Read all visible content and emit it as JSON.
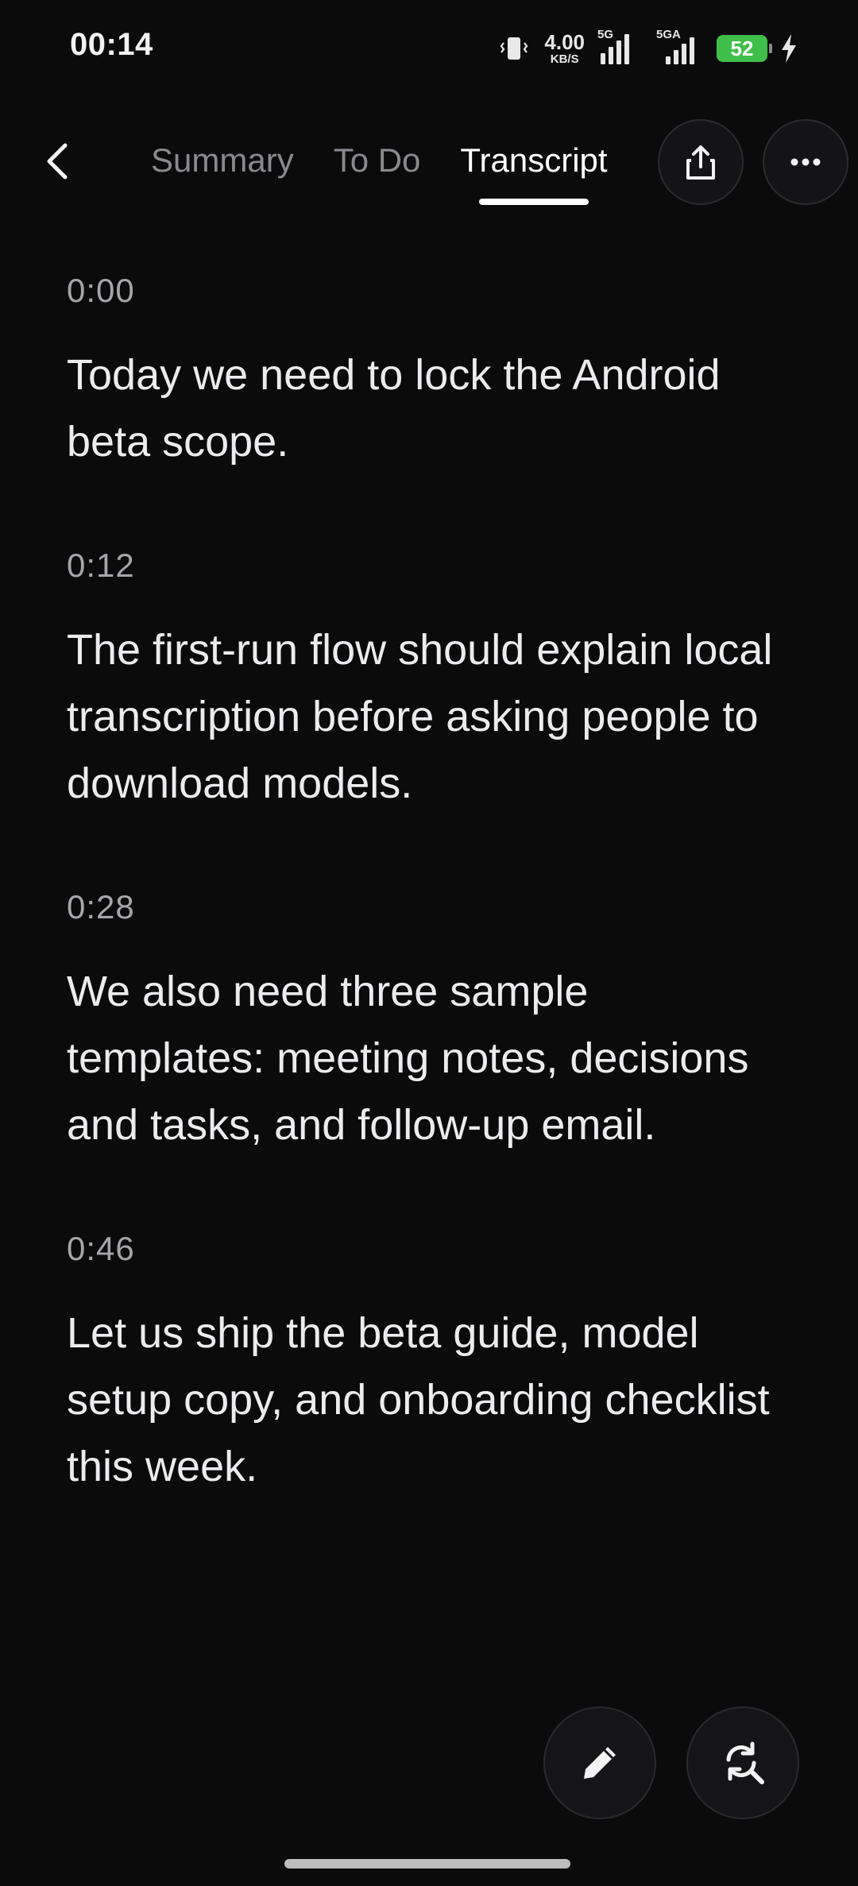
{
  "status_bar": {
    "time": "00:14",
    "net_speed_value": "4.00",
    "net_speed_unit": "KB/S",
    "sim1_label": "5G",
    "sim2_label": "5GA",
    "battery_level": "52",
    "battery_color": "#3fbf4a",
    "icons": [
      "vibrate-icon",
      "signal-icon",
      "battery-icon",
      "charging-bolt-icon"
    ]
  },
  "nav": {
    "back_icon": "chevron-left-icon",
    "tabs": [
      {
        "label": "Summary",
        "active": false
      },
      {
        "label": "To Do",
        "active": false
      },
      {
        "label": "Transcript",
        "active": true
      }
    ],
    "share_icon": "share-icon",
    "more_icon": "more-horizontal-icon"
  },
  "transcript": {
    "segments": [
      {
        "time": "0:00",
        "text": "Today we need to lock the Android beta scope."
      },
      {
        "time": "0:12",
        "text": "The first-run flow should explain local transcription before asking people to download models."
      },
      {
        "time": "0:28",
        "text": "We also need three sample templates: meeting notes, decisions and tasks, and follow-up email."
      },
      {
        "time": "0:46",
        "text": "Let us ship the beta guide, model setup copy, and onboarding checklist this week."
      }
    ]
  },
  "fabs": {
    "edit_icon": "pencil-icon",
    "replace_icon": "find-replace-icon"
  },
  "colors": {
    "background": "#0b0b0c",
    "text_primary": "#ececee",
    "text_muted": "#8a8a8e"
  }
}
